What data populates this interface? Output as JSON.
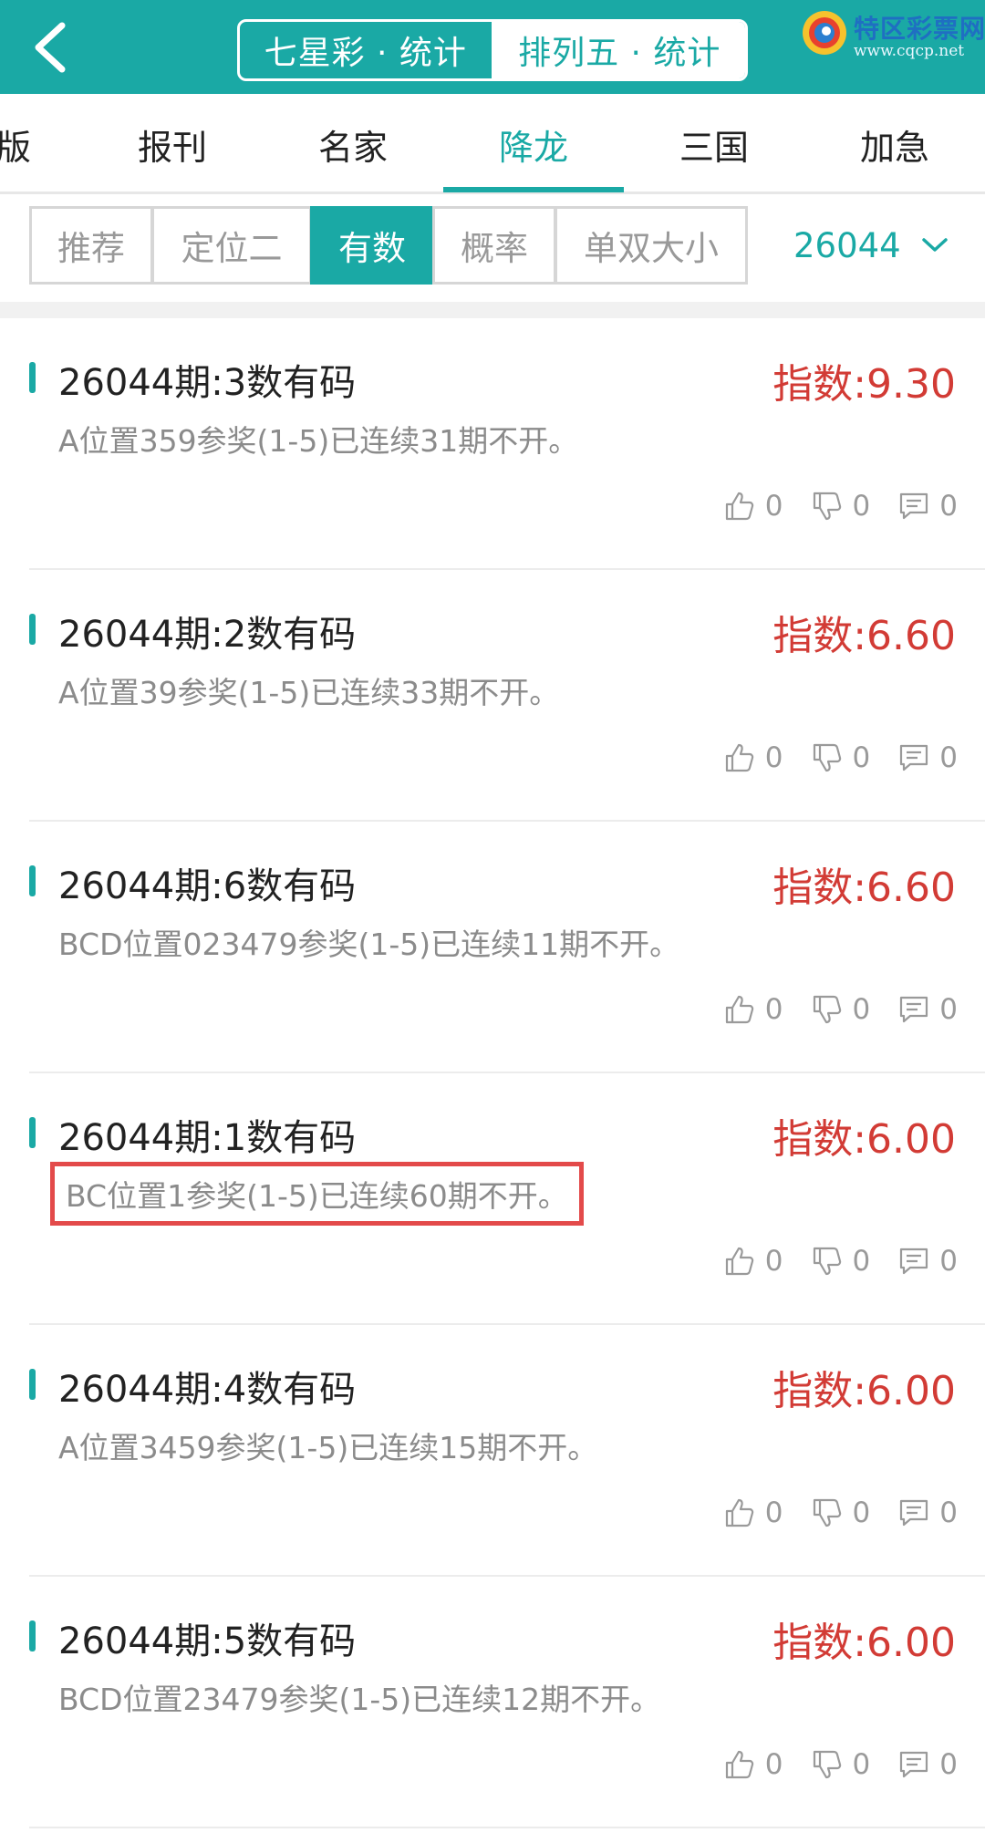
{
  "header": {
    "segments": [
      {
        "label": "七星彩 · 统计",
        "active": false
      },
      {
        "label": "排列五 · 统计",
        "active": true
      }
    ],
    "logo": {
      "name": "特区彩票网",
      "url": "www.cqcp.net"
    },
    "accent_color": "#1aa9a5"
  },
  "categories": [
    {
      "label": "版",
      "active": false
    },
    {
      "label": "报刊",
      "active": false
    },
    {
      "label": "名家",
      "active": false
    },
    {
      "label": "降龙",
      "active": true
    },
    {
      "label": "三国",
      "active": false
    },
    {
      "label": "加急",
      "active": false
    }
  ],
  "filters": [
    {
      "label": "推荐",
      "active": false
    },
    {
      "label": "定位二",
      "active": false
    },
    {
      "label": "有数",
      "active": true
    },
    {
      "label": "概率",
      "active": false
    },
    {
      "label": "单双大小",
      "active": false
    }
  ],
  "issue_select": {
    "value": "26044"
  },
  "cards": [
    {
      "title": "26044期:3数有码",
      "index": "指数:9.30",
      "desc": "A位置359参奖(1-5)已连续31期不开。",
      "likes": "0",
      "dislikes": "0",
      "comments": "0",
      "highlighted": false
    },
    {
      "title": "26044期:2数有码",
      "index": "指数:6.60",
      "desc": "A位置39参奖(1-5)已连续33期不开。",
      "likes": "0",
      "dislikes": "0",
      "comments": "0",
      "highlighted": false
    },
    {
      "title": "26044期:6数有码",
      "index": "指数:6.60",
      "desc": "BCD位置023479参奖(1-5)已连续11期不开。",
      "likes": "0",
      "dislikes": "0",
      "comments": "0",
      "highlighted": false
    },
    {
      "title": "26044期:1数有码",
      "index": "指数:6.00",
      "desc": "BC位置1参奖(1-5)已连续60期不开。",
      "likes": "0",
      "dislikes": "0",
      "comments": "0",
      "highlighted": true
    },
    {
      "title": "26044期:4数有码",
      "index": "指数:6.00",
      "desc": "A位置3459参奖(1-5)已连续15期不开。",
      "likes": "0",
      "dislikes": "0",
      "comments": "0",
      "highlighted": false
    },
    {
      "title": "26044期:5数有码",
      "index": "指数:6.00",
      "desc": "BCD位置23479参奖(1-5)已连续12期不开。",
      "likes": "0",
      "dislikes": "0",
      "comments": "0",
      "highlighted": false
    }
  ],
  "colors": {
    "index_red": "#d23b35",
    "highlight_box": "#e34a4a"
  }
}
